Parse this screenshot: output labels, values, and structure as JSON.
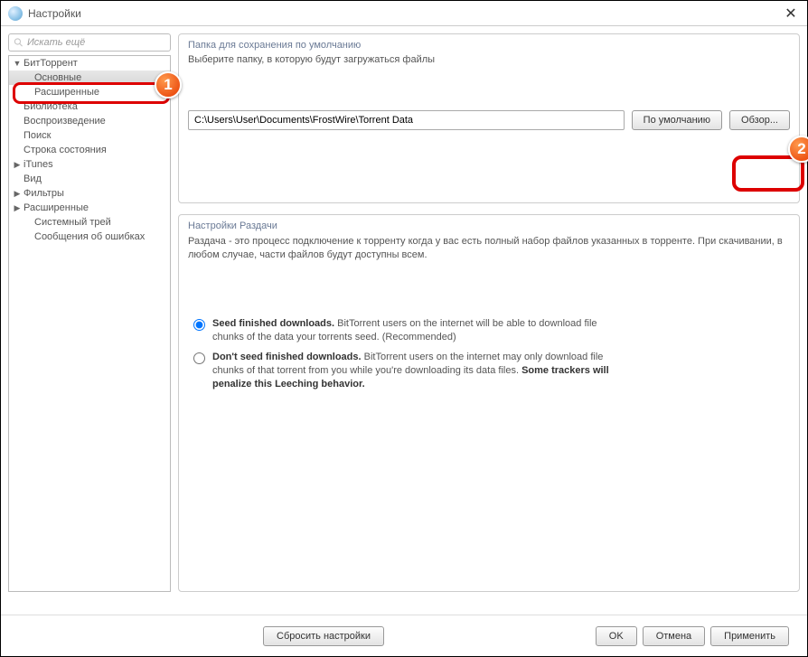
{
  "window": {
    "title": "Настройки"
  },
  "search": {
    "placeholder": "Искать ещё"
  },
  "sidebar": {
    "items": [
      {
        "label": "БитТоррент",
        "depth": 0,
        "arrow": "▼",
        "selected": false
      },
      {
        "label": "Основные",
        "depth": 1,
        "arrow": "",
        "selected": true
      },
      {
        "label": "Расширенные",
        "depth": 1,
        "arrow": "",
        "selected": false
      },
      {
        "label": "Библиотека",
        "depth": 0,
        "arrow": "",
        "selected": false
      },
      {
        "label": "Воспроизведение",
        "depth": 0,
        "arrow": "",
        "selected": false
      },
      {
        "label": "Поиск",
        "depth": 0,
        "arrow": "",
        "selected": false
      },
      {
        "label": "Строка состояния",
        "depth": 0,
        "arrow": "",
        "selected": false
      },
      {
        "label": "iTunes",
        "depth": 0,
        "arrow": "▶",
        "selected": false
      },
      {
        "label": "Вид",
        "depth": 0,
        "arrow": "",
        "selected": false
      },
      {
        "label": "Фильтры",
        "depth": 0,
        "arrow": "▶",
        "selected": false
      },
      {
        "label": "Расширенные",
        "depth": 0,
        "arrow": "▶",
        "selected": false
      },
      {
        "label": "Системный трей",
        "depth": 1,
        "arrow": "",
        "selected": false
      },
      {
        "label": "Сообщения об ошибках",
        "depth": 1,
        "arrow": "",
        "selected": false
      }
    ]
  },
  "panelFolder": {
    "title": "Папка для сохранения по умолчанию",
    "desc": "Выберите папку, в которую будут загружаться файлы",
    "path": "C:\\Users\\User\\Documents\\FrostWire\\Torrent Data",
    "defaultBtn": "По умолчанию",
    "browseBtn": "Обзор..."
  },
  "panelSeed": {
    "title": "Настройки Раздачи",
    "desc": "Раздача - это процесс подключение к торренту когда у вас есть полный набор файлов указанных в торренте. При скачивании, в любом случае, части файлов будут доступны всем.",
    "opt1_bold": "Seed finished downloads.",
    "opt1_rest": " BitTorrent users on the internet will be able to download file chunks of the data your torrents seed. (Recommended)",
    "opt2_bold": "Don't seed finished downloads.",
    "opt2_mid": " BitTorrent users on the internet may only download file chunks of that torrent from you while you're downloading its data files. ",
    "opt2_bold2": "Some trackers will penalize this Leeching behavior."
  },
  "footer": {
    "reset": "Сбросить настройки",
    "ok": "OK",
    "cancel": "Отмена",
    "apply": "Применить"
  },
  "callouts": {
    "one": "1",
    "two": "2"
  }
}
